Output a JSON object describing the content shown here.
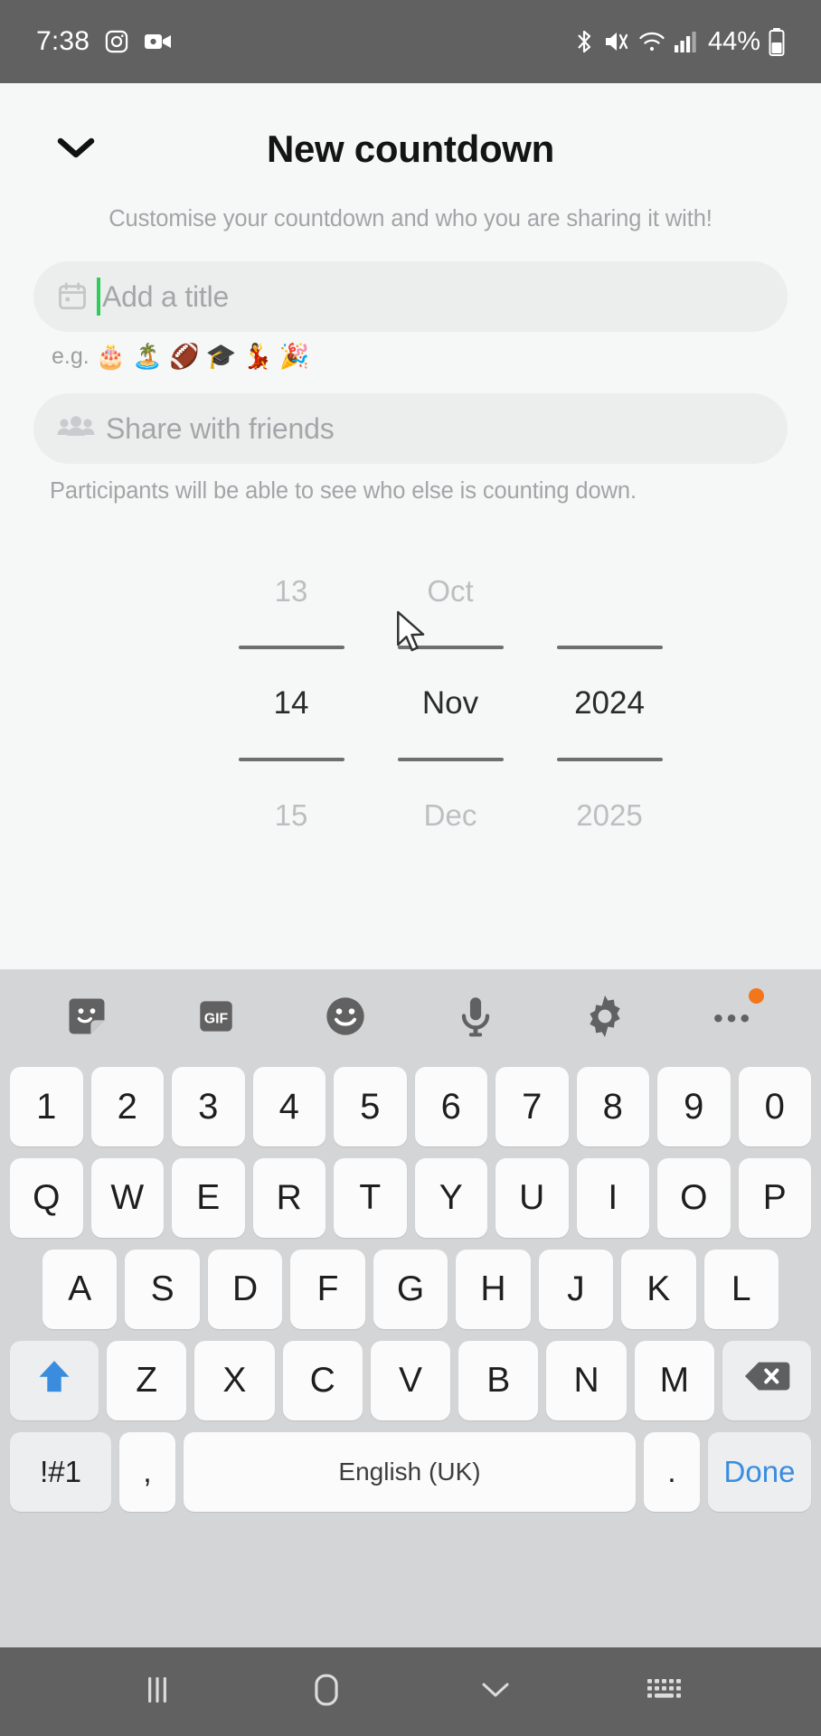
{
  "status_bar": {
    "time": "7:38",
    "battery_percent": "44%",
    "icons": [
      "instagram-icon",
      "video-camera-icon",
      "bluetooth-icon",
      "mute-icon",
      "wifi-icon",
      "signal-icon",
      "battery-icon"
    ],
    "background": "#616161"
  },
  "app": {
    "title": "New countdown",
    "subtitle": "Customise your countdown and who you are sharing it with!",
    "collapse_icon": "chevron-down-icon",
    "title_field": {
      "icon": "calendar-icon",
      "placeholder": "Add a title",
      "value": "",
      "caret_color": "#2ecc5a"
    },
    "examples": {
      "label": "e.g.",
      "emojis": [
        "🎂",
        "🏝️",
        "🏈",
        "🎓",
        "💃",
        "🎉"
      ]
    },
    "share_field": {
      "icon": "people-group-icon",
      "placeholder": "Share with friends",
      "value": ""
    },
    "share_helper": "Participants will be able to see who else is counting down.",
    "date_picker": {
      "day": {
        "prev": "13",
        "selected": "14",
        "next": "15"
      },
      "month": {
        "prev": "Oct",
        "selected": "Nov",
        "next": "Dec"
      },
      "year": {
        "prev": "",
        "selected": "2024",
        "next": "2025"
      }
    }
  },
  "keyboard": {
    "toolbar": [
      {
        "name": "sticker-icon"
      },
      {
        "name": "gif-icon",
        "label": "GIF"
      },
      {
        "name": "emoji-icon"
      },
      {
        "name": "microphone-icon"
      },
      {
        "name": "settings-gear-icon"
      },
      {
        "name": "more-options-icon",
        "badge": "#f4761a"
      }
    ],
    "rows": {
      "numbers": [
        "1",
        "2",
        "3",
        "4",
        "5",
        "6",
        "7",
        "8",
        "9",
        "0"
      ],
      "top": [
        "Q",
        "W",
        "E",
        "R",
        "T",
        "Y",
        "U",
        "I",
        "O",
        "P"
      ],
      "home": [
        "A",
        "S",
        "D",
        "F",
        "G",
        "H",
        "J",
        "K",
        "L"
      ],
      "bottom": [
        "Z",
        "X",
        "C",
        "V",
        "B",
        "N",
        "M"
      ]
    },
    "shift_key": {
      "name": "shift-key",
      "icon": "arrow-up-icon",
      "active_color": "#3a8dde"
    },
    "backspace_key": {
      "name": "backspace-key",
      "icon": "backspace-icon"
    },
    "symbols_key": "!#1",
    "comma_key": ",",
    "space_key": "English (UK)",
    "period_key": ".",
    "done_key": "Done",
    "done_color": "#3a8dde",
    "background": "#d4d5d7"
  },
  "nav_bar": {
    "recents": "recents-icon",
    "home": "home-icon",
    "back": "back-chevron-icon",
    "hide_keyboard": "hide-keyboard-icon",
    "background": "#616161"
  }
}
